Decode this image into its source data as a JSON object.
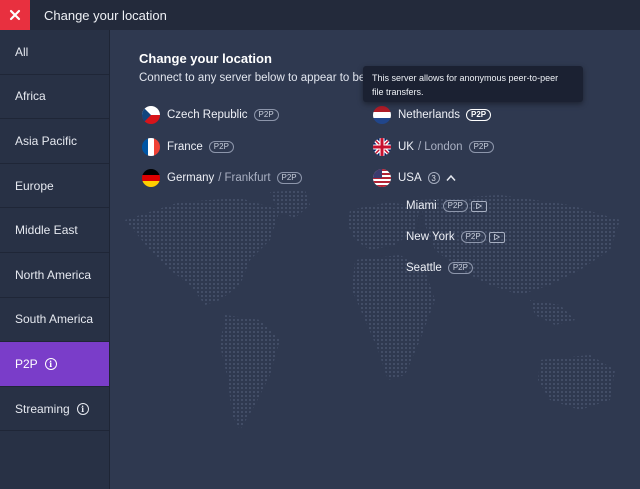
{
  "window": {
    "title": "Change your location"
  },
  "sidebar": {
    "items": [
      {
        "label": "All"
      },
      {
        "label": "Africa"
      },
      {
        "label": "Asia Pacific"
      },
      {
        "label": "Europe"
      },
      {
        "label": "Middle East"
      },
      {
        "label": "North America"
      },
      {
        "label": "South America"
      },
      {
        "label": "P2P",
        "active": true
      },
      {
        "label": "Streaming"
      }
    ]
  },
  "main": {
    "heading": "Change your location",
    "subheading": "Connect to any server below to appear to be in",
    "tooltip": {
      "line1": "This server allows for anonymous peer-to-peer",
      "line2": "file transfers."
    },
    "p2p_label": "P2P",
    "left_column": [
      {
        "country": "Czech Republic",
        "flag": "czech-flag"
      },
      {
        "country": "France",
        "flag": "france-flag"
      },
      {
        "country": "Germany",
        "city": "Frankfurt",
        "flag": "germany-flag"
      }
    ],
    "right_column": [
      {
        "country": "Netherlands",
        "flag": "netherlands-flag"
      },
      {
        "country": "UK",
        "city": "London",
        "flag": "uk-flag"
      },
      {
        "country": "USA",
        "count": "3",
        "flag": "usa-flag"
      }
    ],
    "usa_cities": [
      {
        "name": "Miami",
        "streaming": true
      },
      {
        "name": "New York",
        "streaming": true
      },
      {
        "name": "Seattle",
        "streaming": false
      }
    ],
    "separator": "/"
  },
  "colors": {
    "accent": "#7a3dc9",
    "close": "#e8303f",
    "background": "#2f3950",
    "sidebar": "#283145",
    "titlebar": "#232a3b"
  }
}
